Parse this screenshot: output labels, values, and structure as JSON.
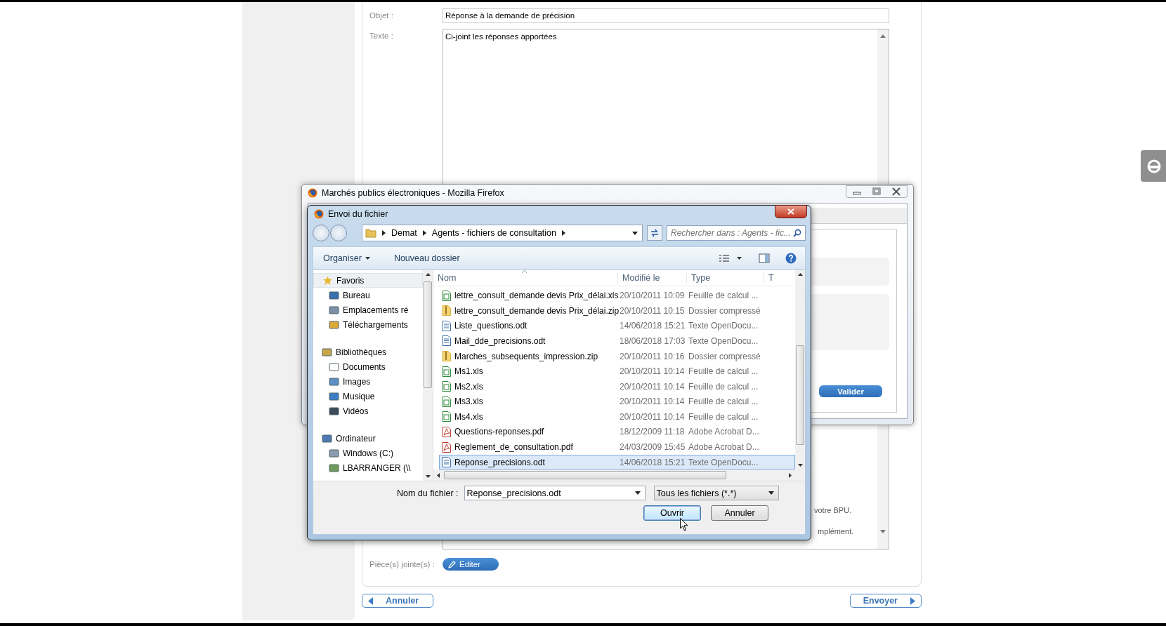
{
  "form": {
    "subject": {
      "label": "Objet :",
      "value": "Réponse à la demande de précision"
    },
    "body": {
      "label": "Texte :",
      "value": "Ci-joint les réponses apportées",
      "fragments": [
        "votre BPU.",
        "mplément."
      ]
    },
    "attachments": {
      "label": "Pièce(s) jointe(s) :",
      "button": "Editer"
    },
    "buttons": [
      {
        "label": "Annuler",
        "kind": "back"
      },
      {
        "label": "Envoyer",
        "kind": "next"
      }
    ]
  },
  "browser_window": {
    "title": "Marchés publics électroniques - Mozilla Firefox",
    "button": "Valider"
  },
  "file_dialog": {
    "title": "Envoi du fichier",
    "breadcrumb": [
      "Demat",
      "Agents - fichiers de consultation"
    ],
    "search": {
      "placeholder": "Rechercher dans : Agents - fic..."
    },
    "toolbar": [
      "Organiser",
      "Nouveau dossier"
    ],
    "sidebar": [
      {
        "label": "Favoris",
        "kind": "star",
        "selected": true,
        "children": [
          {
            "label": "Bureau",
            "kind": "desktop",
            "selected": false
          },
          {
            "label": "Emplacements ré",
            "kind": "places",
            "selected": false
          },
          {
            "label": "Téléchargements",
            "kind": "download",
            "selected": false
          }
        ]
      },
      {
        "label": "Bibliothèques",
        "kind": "library",
        "selected": false,
        "children": [
          {
            "label": "Documents",
            "kind": "doc",
            "selected": false
          },
          {
            "label": "Images",
            "kind": "image",
            "selected": false
          },
          {
            "label": "Musique",
            "kind": "music",
            "selected": false
          },
          {
            "label": "Vidéos",
            "kind": "video",
            "selected": false
          }
        ]
      },
      {
        "label": "Ordinateur",
        "kind": "computer",
        "selected": false,
        "children": [
          {
            "label": "Windows (C:)",
            "kind": "drive",
            "selected": false
          },
          {
            "label": "LBARRANGER (\\\\",
            "kind": "network",
            "selected": false
          }
        ]
      }
    ],
    "columns": [
      "Nom",
      "Modifié le",
      "Type",
      "T"
    ],
    "rows": [
      {
        "name": "lettre_consult_demande devis Prix_délai.xls",
        "modified": "20/10/2011 10:09",
        "type": "Feuille de calcul ...",
        "kind": "xls",
        "selected": false
      },
      {
        "name": "lettre_consult_demande devis Prix_délai.zip",
        "modified": "20/10/2011 10:15",
        "type": "Dossier compressé",
        "kind": "zip",
        "selected": false
      },
      {
        "name": "Liste_questions.odt",
        "modified": "14/06/2018 15:21",
        "type": "Texte OpenDocu...",
        "kind": "odt",
        "selected": false
      },
      {
        "name": "Mail_dde_precisions.odt",
        "modified": "18/06/2018 17:03",
        "type": "Texte OpenDocu...",
        "kind": "odt",
        "selected": false
      },
      {
        "name": "Marches_subsequents_impression.zip",
        "modified": "20/10/2011 10:16",
        "type": "Dossier compressé",
        "kind": "zip",
        "selected": false
      },
      {
        "name": "Ms1.xls",
        "modified": "20/10/2011 10:14",
        "type": "Feuille de calcul ...",
        "kind": "xls",
        "selected": false
      },
      {
        "name": "Ms2.xls",
        "modified": "20/10/2011 10:14",
        "type": "Feuille de calcul ...",
        "kind": "xls",
        "selected": false
      },
      {
        "name": "Ms3.xls",
        "modified": "20/10/2011 10:14",
        "type": "Feuille de calcul ...",
        "kind": "xls",
        "selected": false
      },
      {
        "name": "Ms4.xls",
        "modified": "20/10/2011 10:14",
        "type": "Feuille de calcul ...",
        "kind": "xls",
        "selected": false
      },
      {
        "name": "Questions-reponses.pdf",
        "modified": "18/12/2009 11:18",
        "type": "Adobe Acrobat D...",
        "kind": "pdf",
        "selected": false
      },
      {
        "name": "Reglement_de_consultation.pdf",
        "modified": "24/03/2009 15:45",
        "type": "Adobe Acrobat D...",
        "kind": "pdf",
        "selected": false
      },
      {
        "name": "Reponse_precisions.odt",
        "modified": "14/06/2018 15:21",
        "type": "Texte OpenDocu...",
        "kind": "odt",
        "selected": true
      }
    ],
    "filename": {
      "label": "Nom du fichier :",
      "value": "Reponse_precisions.odt"
    },
    "filter": "Tous les fichiers (*.*)",
    "buttons": [
      {
        "label": "Ouvrir",
        "kind": "default"
      },
      {
        "label": "Annuler",
        "kind": "normal"
      }
    ]
  }
}
